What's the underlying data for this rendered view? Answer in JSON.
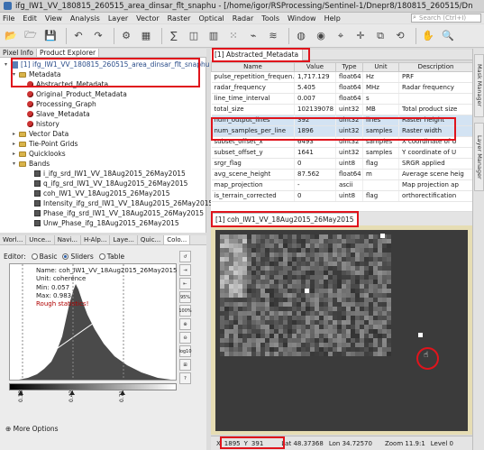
{
  "window": {
    "title": "ifg_IW1_VV_180815_260515_area_dinsar_flt_snaphu - [/home/igor/RSProcessing/Sentinel-1/Dnepr8/180815_260515/Dn"
  },
  "menu": [
    "File",
    "Edit",
    "View",
    "Analysis",
    "Layer",
    "Vector",
    "Raster",
    "Optical",
    "Radar",
    "Tools",
    "Window",
    "Help"
  ],
  "search": {
    "placeholder": "Search (Ctrl+I)"
  },
  "left_tabs": [
    "Pixel Info",
    "Product Explorer"
  ],
  "tree": {
    "product": "[1] ifg_IW1_VV_180815_260515_area_dinsar_flt_snaphu",
    "metadata": "Metadata",
    "metadata_items": [
      "Abstracted_Metadata",
      "Original_Product_Metadata",
      "Processing_Graph",
      "Slave_Metadata",
      "history"
    ],
    "vector_data": "Vector Data",
    "tie_point_grids": "Tie-Point Grids",
    "quicklooks": "Quicklooks",
    "bands_label": "Bands",
    "bands": [
      "i_ifg_srd_IW1_VV_18Aug2015_26May2015",
      "q_ifg_srd_IW1_VV_18Aug2015_26May2015",
      "coh_IW1_VV_18Aug2015_26May2015",
      "Intensity_ifg_srd_IW1_VV_18Aug2015_26May2015",
      "Phase_ifg_srd_IW1_VV_18Aug2015_26May2015",
      "Unw_Phase_ifg_18Aug2015_26May2015"
    ]
  },
  "lower_tabs": [
    "Worl...",
    "Unce...",
    "Navi...",
    "H-Alp...",
    "Laye...",
    "Quic...",
    "Colo..."
  ],
  "editor": {
    "label": "Editor:",
    "options": [
      "Basic",
      "Sliders",
      "Table"
    ],
    "selected": "Sliders"
  },
  "histogram": {
    "name": "Name: coh_IW1_VV_18Aug2015_26May2015",
    "unit": "Unit: coherence",
    "min": "Min: 0.057",
    "max": "Max: 0.983",
    "warning": "Rough statistics!",
    "slider_labels": [
      "0.13",
      "0.42",
      "0.71"
    ],
    "side_buttons": [
      "95%",
      "100%",
      "log10"
    ]
  },
  "more_options": "More Options",
  "metadata_panel": {
    "tab": "[1] Abstracted_Metadata",
    "columns": [
      "Name",
      "Value",
      "Type",
      "Unit",
      "Description"
    ],
    "rows": [
      [
        "pulse_repetition_frequen...",
        "1,717.129",
        "float64",
        "Hz",
        "PRF"
      ],
      [
        "radar_frequency",
        "5.405",
        "float64",
        "MHz",
        "Radar frequency"
      ],
      [
        "line_time_interval",
        "0.007",
        "float64",
        "s",
        ""
      ],
      [
        "total_size",
        "102139078",
        "uint32",
        "MB",
        "Total product size"
      ],
      [
        "num_output_lines",
        "392",
        "uint32",
        "lines",
        "Raster height"
      ],
      [
        "num_samples_per_line",
        "1896",
        "uint32",
        "samples",
        "Raster width"
      ],
      [
        "subset_offset_x",
        "6493",
        "uint32",
        "samples",
        "X coordinate of U"
      ],
      [
        "subset_offset_y",
        "1641",
        "uint32",
        "samples",
        "Y coordinate of U"
      ],
      [
        "srgr_flag",
        "0",
        "uint8",
        "flag",
        "SRGR applied"
      ],
      [
        "avg_scene_height",
        "87.562",
        "float64",
        "m",
        "Average scene heig"
      ],
      [
        "map_projection",
        "-",
        "ascii",
        "",
        "Map projection ap"
      ],
      [
        "is_terrain_corrected",
        "0",
        "uint8",
        "flag",
        "orthorectification"
      ]
    ]
  },
  "image_view": {
    "tab": "[1] coh_IW1_VV_18Aug2015_26May2015"
  },
  "right_tabs": [
    "Mask Manager",
    "Layer Manager"
  ],
  "status": {
    "x_label": "X",
    "x": "1895",
    "y_label": "Y",
    "y": "391",
    "lat": "Lat 48.37368",
    "lon": "Lon 34.72570",
    "zoom": "Zoom 11.9:1",
    "level": "Level 0"
  },
  "colors": {
    "highlight": "#e0141c",
    "selection_row": "#d3e3f3",
    "image_frame": "#e6ddb4"
  }
}
